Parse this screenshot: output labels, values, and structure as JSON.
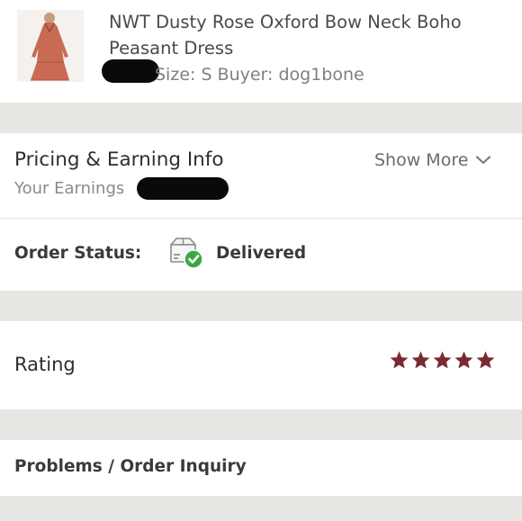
{
  "item": {
    "title": "NWT Dusty Rose Oxford Bow Neck Boho Peasant Dress",
    "meta": "Size: S  Buyer: dog1bone"
  },
  "pricing": {
    "title": "Pricing & Earning Info",
    "earnings_label": "Your Earnings",
    "show_more": "Show More"
  },
  "order_status": {
    "label": "Order Status:",
    "value": "Delivered"
  },
  "rating": {
    "label": "Rating",
    "stars": 5,
    "star_color": "#7a2a33"
  },
  "problems": {
    "label": "Problems / Order Inquiry"
  }
}
